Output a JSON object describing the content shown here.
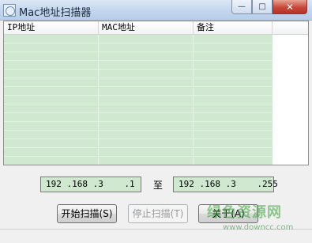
{
  "window": {
    "title": "Mac地址扫描器",
    "caption_buttons": {
      "minimize": "—",
      "maximize": "□",
      "close": "✕"
    }
  },
  "list": {
    "columns": [
      "IP地址",
      "MAC地址",
      "备注",
      ""
    ]
  },
  "range": {
    "start_ip": "192 .168 .3    .1",
    "to_label": "至",
    "end_ip": "192 .168 .3    .255"
  },
  "buttons": {
    "start_scan": "开始扫描(S)",
    "stop_scan": "停止扫描(T)",
    "about": "关于(A)"
  },
  "watermark": {
    "logo": "绿色资源网",
    "url": "www.downcc.com"
  }
}
